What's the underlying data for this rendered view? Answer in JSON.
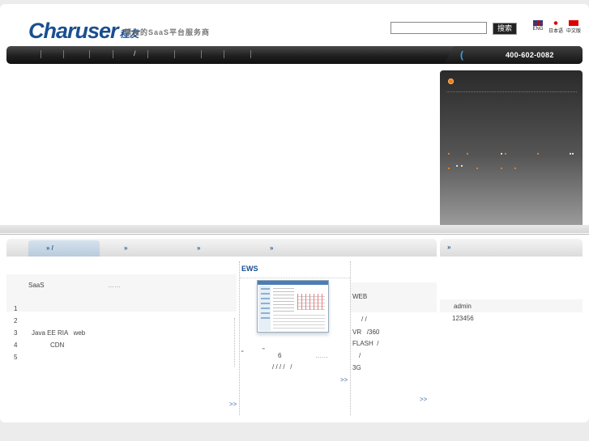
{
  "header": {
    "logo_main": "Charuser",
    "logo_sub": "程友",
    "tagline": "领先的SaaS平台服务商",
    "search_placeholder": "",
    "search_button": "搜索",
    "languages": [
      "ENG",
      "日本语",
      "中文版"
    ],
    "phone": "400-602-0082"
  },
  "nav": {
    "slash": "/"
  },
  "tabs": [
    {
      "label": "» /",
      "active": true
    },
    {
      "label": "»",
      "active": false
    },
    {
      "label": "»",
      "active": false
    },
    {
      "label": "»",
      "active": false
    }
  ],
  "left_col": {
    "saas": "SaaS",
    "saas_dots": "……",
    "items": [
      "1",
      "2",
      "3",
      "4",
      "5"
    ],
    "item3_text": "Java EE RIA   web",
    "item4_text": "CDN",
    "more": ">>"
  },
  "middle_col": {
    "title": "EWS",
    "caption_left": "“",
    "caption_mid": "”",
    "caption_num": "6",
    "caption_dots": "……",
    "caption_slashes": "/ / / /   /",
    "more": ">>"
  },
  "third_col": {
    "web": "WEB",
    "slashes": "/ /",
    "vr": "VR   /360",
    "flash": "FLASH  /",
    "slash2": "/",
    "g3": "3G",
    "more": ">>"
  },
  "right_box": {
    "tab_label": "»",
    "user": "admin",
    "password": "123456"
  },
  "colors": {
    "accent": "#1a4f8f",
    "orange": "#f07a1a",
    "phone_icon": "#3ba0e6"
  }
}
